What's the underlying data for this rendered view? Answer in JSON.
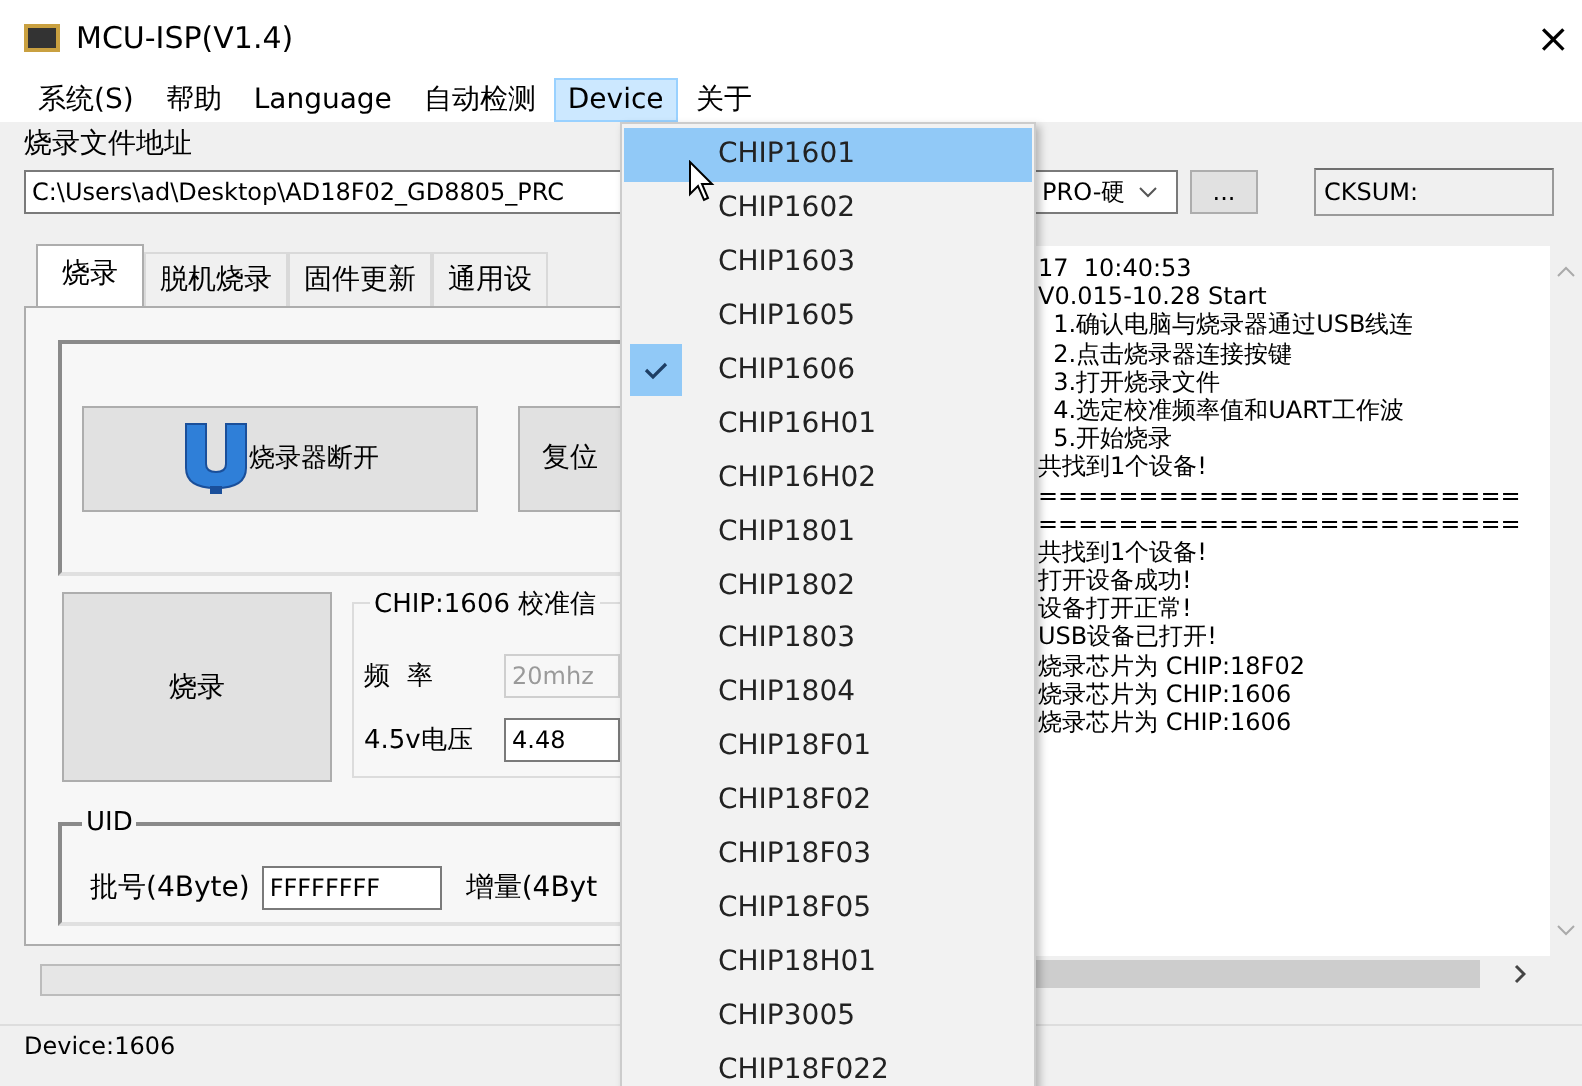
{
  "window": {
    "title": "MCU-ISP(V1.4)",
    "close": "×"
  },
  "menu_bar": [
    {
      "label": "系统(S)",
      "selected": false
    },
    {
      "label": "帮助",
      "selected": false
    },
    {
      "label": "Language",
      "selected": false
    },
    {
      "label": "自动检测",
      "selected": false
    },
    {
      "label": "Device",
      "selected": true
    },
    {
      "label": "关于",
      "selected": false
    }
  ],
  "file_section": {
    "label": "烧录文件地址",
    "path": "C:\\Users\\ad\\Desktop\\AD18F02_GD8805_PRC",
    "combo": "PRO-硬",
    "browse": "...",
    "checksum": "CKSUM:"
  },
  "tabs": [
    {
      "label": "烧录",
      "selected": true
    },
    {
      "label": "脱机烧录",
      "selected": false
    },
    {
      "label": "固件更新",
      "selected": false
    },
    {
      "label": "通用设",
      "selected": false
    }
  ],
  "burn_tab": {
    "connect_button": "烧录器断开",
    "reset_button": "复位",
    "burn_button": "烧录",
    "calibration": {
      "legend": "CHIP:1606 校准信",
      "rows": [
        {
          "label": "频  率",
          "value": "20mhz",
          "disabled": true
        },
        {
          "label": "4.5v电压",
          "value": "4.48",
          "disabled": false
        }
      ]
    },
    "uid": {
      "legend": "UID",
      "batch_label": "批号(4Byte)",
      "batch_value": "FFFFFFFF",
      "increment_label": "增量(4Byt"
    }
  },
  "log": [
    "17  10:40:53",
    "V0.015-10.28 Start",
    "  1.确认电脑与烧录器通过USB线连",
    "  2.点击烧录器连接按键",
    "  3.打开烧录文件",
    "  4.选定校准频率值和UART工作波",
    "  5.开始烧录",
    "共找到1个设备!",
    "========================",
    "========================",
    "共找到1个设备!",
    "打开设备成功!",
    "设备打开正常!",
    "USB设备已打开!",
    "烧录芯片为 CHIP:18F02",
    "烧录芯片为 CHIP:1606",
    "烧录芯片为 CHIP:1606"
  ],
  "progress": {
    "level": 0
  },
  "status_bar": "Device:1606",
  "device_menu": [
    {
      "label": "CHIP1601",
      "highlighted": true,
      "checked": false
    },
    {
      "label": "CHIP1602",
      "highlighted": false,
      "checked": false
    },
    {
      "label": "CHIP1603",
      "highlighted": false,
      "checked": false
    },
    {
      "label": "CHIP1605",
      "highlighted": false,
      "checked": false
    },
    {
      "label": "CHIP1606",
      "highlighted": false,
      "checked": true
    },
    {
      "label": "CHIP16H01",
      "highlighted": false,
      "checked": false
    },
    {
      "label": "CHIP16H02",
      "highlighted": false,
      "checked": false
    },
    {
      "label": "CHIP1801",
      "highlighted": false,
      "checked": false
    },
    {
      "label": "CHIP1802",
      "highlighted": false,
      "checked": false
    },
    {
      "label": "CHIP1803",
      "highlighted": false,
      "checked": false
    },
    {
      "label": "CHIP1804",
      "highlighted": false,
      "checked": false
    },
    {
      "label": "CHIP18F01",
      "highlighted": false,
      "checked": false
    },
    {
      "label": "CHIP18F02",
      "highlighted": false,
      "checked": false
    },
    {
      "label": "CHIP18F03",
      "highlighted": false,
      "checked": false
    },
    {
      "label": "CHIP18F05",
      "highlighted": false,
      "checked": false
    },
    {
      "label": "CHIP18H01",
      "highlighted": false,
      "checked": false
    },
    {
      "label": "CHIP3005",
      "highlighted": false,
      "checked": false
    },
    {
      "label": "CHIP18F022",
      "highlighted": false,
      "checked": false
    }
  ]
}
